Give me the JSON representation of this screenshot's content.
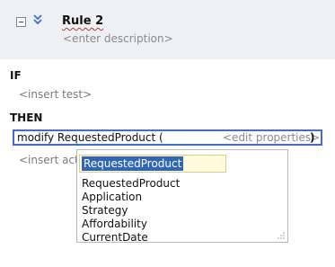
{
  "rule": {
    "title": "Rule 2",
    "description_placeholder": "<enter description>"
  },
  "if_section": {
    "keyword": "IF",
    "insert_test": "<insert test>"
  },
  "then_section": {
    "keyword": "THEN",
    "action": {
      "text": "modify RequestedProduct (",
      "edit_properties": "<edit properties>",
      "close": ")"
    },
    "insert_action": "<insert action>"
  },
  "dropdown": {
    "search_value": "RequestedProduct",
    "options": [
      "RequestedProduct",
      "Application",
      "Strategy",
      "Affordability",
      "CurrentDate"
    ]
  },
  "icons": {
    "collapse": "collapse-box-icon",
    "chevrons": "double-chevron-down-icon",
    "grip": "resize-grip-icon"
  },
  "colors": {
    "header_bg": "#eef0f3",
    "focus_border": "#3b6fd6",
    "selection": "#2f67b5",
    "search_bg": "#fffbdc"
  }
}
